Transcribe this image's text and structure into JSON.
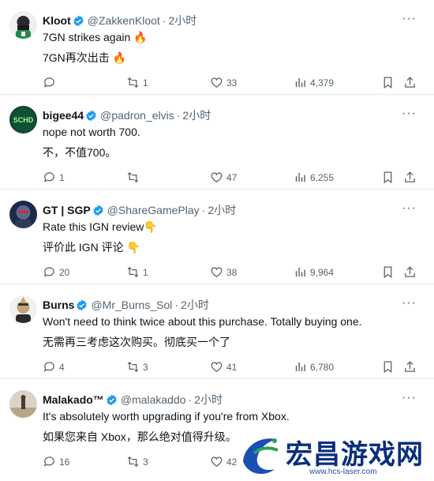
{
  "tweets": [
    {
      "name": "Kloot",
      "handle": "@ZakkenKloot",
      "time": "2小时",
      "line1": "7GN strikes again 🔥",
      "line2": "7GN再次出击 🔥",
      "replies": "",
      "retweets": "1",
      "likes": "33",
      "views": "4,379"
    },
    {
      "name": "bigee44",
      "handle": "@padron_elvis",
      "time": "2小时",
      "avatar_text": "SCHD",
      "line1": "nope not worth 700.",
      "line2": "不，不值700。",
      "replies": "1",
      "retweets": "",
      "likes": "47",
      "views": "6,255"
    },
    {
      "name": "GT | SGP",
      "handle": "@ShareGamePlay",
      "time": "2小时",
      "line1": "Rate this IGN review👇",
      "line2": "评价此 IGN 评论 👇",
      "replies": "20",
      "retweets": "1",
      "likes": "38",
      "views": "9,964"
    },
    {
      "name": "Burns",
      "handle": "@Mr_Burns_Sol",
      "time": "2小时",
      "line1": "Won't need to think twice about this purchase. Totally buying one.",
      "line2": "无需再三考虑这次购买。彻底买一个了",
      "replies": "4",
      "retweets": "3",
      "likes": "41",
      "views": "6,780"
    },
    {
      "name": "Malakado™",
      "handle": "@malakaddo",
      "time": "2小时",
      "line1": "It's absolutely worth upgrading if you're from Xbox.",
      "line2": "如果您来自 Xbox，那么绝对值得升级。",
      "replies": "16",
      "retweets": "3",
      "likes": "42",
      "views": ""
    }
  ],
  "ui": {
    "dot": "·",
    "more": "···"
  },
  "watermark": {
    "title": "宏昌游戏网",
    "url": "www.hcs-laser.com"
  },
  "colors": {
    "verified": "#1d9bf0",
    "muted": "#536471",
    "watermark": "#0a2f7d"
  }
}
